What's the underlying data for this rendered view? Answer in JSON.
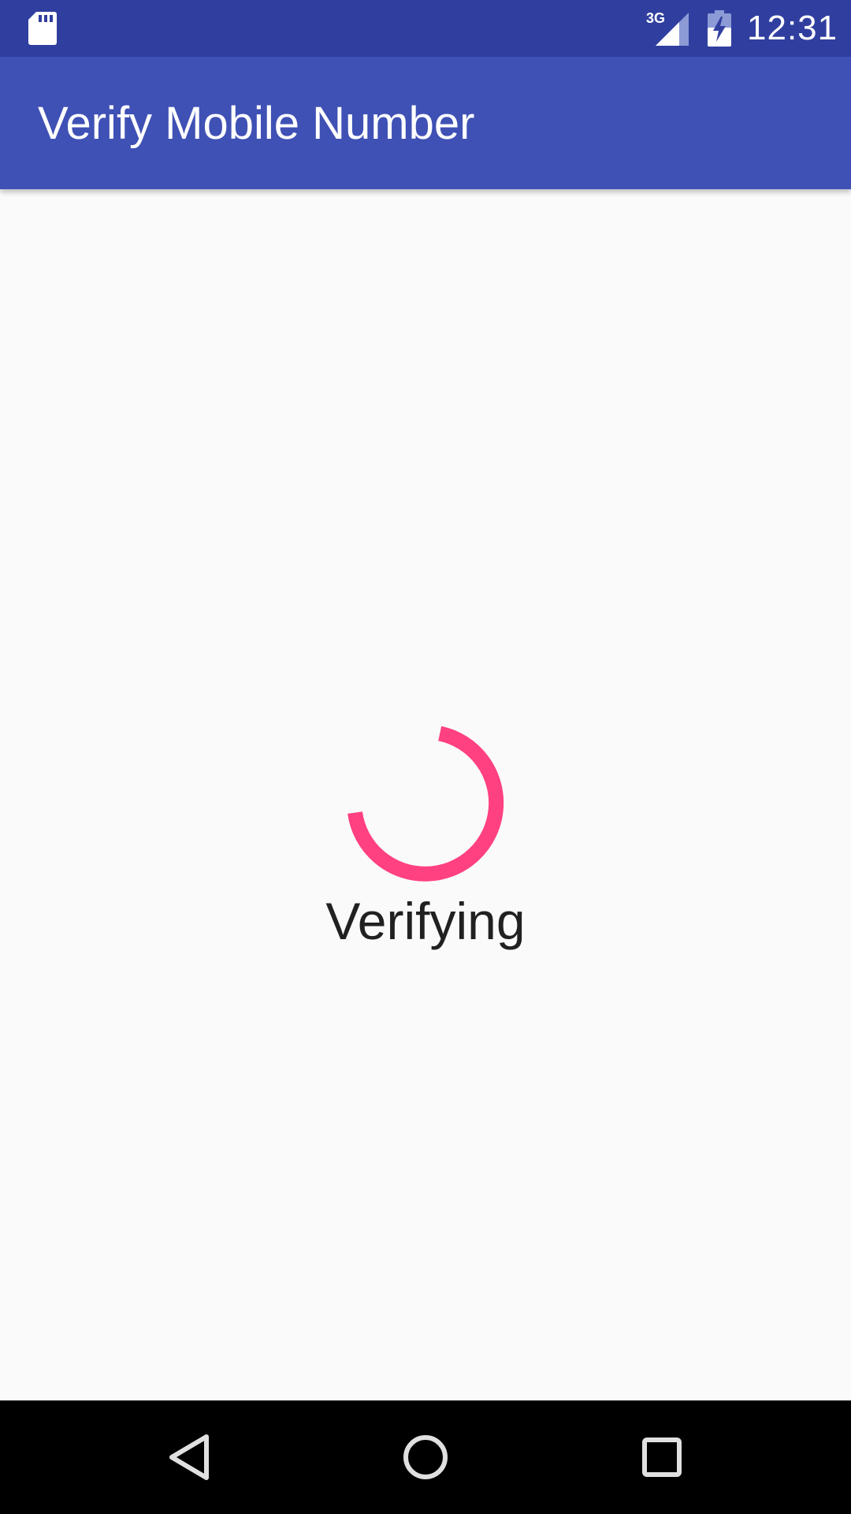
{
  "status_bar": {
    "time": "12:31",
    "network": "3G",
    "icons": [
      "sd-card-icon",
      "signal-3g-icon",
      "battery-charging-icon"
    ]
  },
  "app_bar": {
    "title": "Verify Mobile Number"
  },
  "content": {
    "status": "Verifying",
    "spinner_color": "#ff4081"
  },
  "nav_bar": {
    "icons": [
      "back-icon",
      "home-icon",
      "recents-icon"
    ]
  },
  "colors": {
    "status_bar": "#303f9f",
    "app_bar": "#3f51b5",
    "background": "#fafafa",
    "accent": "#ff4081",
    "nav_bar": "#000000"
  }
}
